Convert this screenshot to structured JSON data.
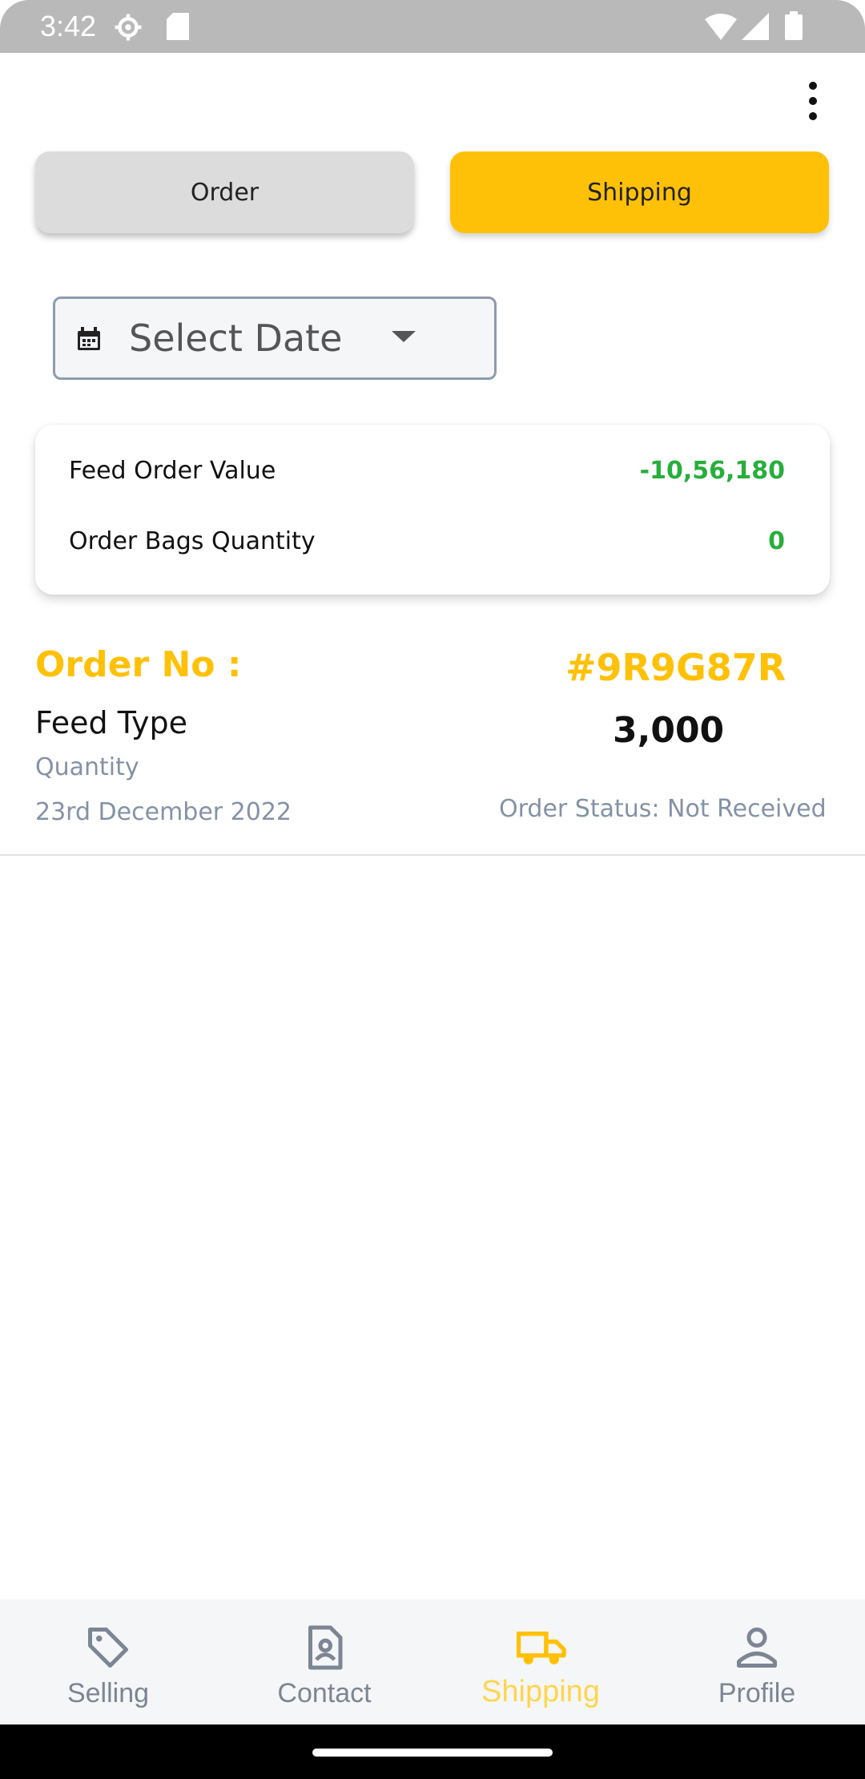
{
  "status_bar": {
    "time": "3:42"
  },
  "tabs": {
    "order": "Order",
    "shipping": "Shipping",
    "active": "shipping"
  },
  "date_filter": {
    "placeholder": "Select Date"
  },
  "summary": {
    "feed_order_value_label": "Feed Order Value",
    "feed_order_value": "-10,56,180",
    "order_bags_quantity_label": "Order Bags Quantity",
    "order_bags_quantity": "0",
    "value_color": "#27ae3c"
  },
  "order": {
    "order_no_label": "Order No :",
    "order_no": "#9R9G87R",
    "feed_type": "Feed Type",
    "quantity_value": "3,000",
    "quantity_label": "Quantity",
    "date": "23rd December 2022",
    "status": "Order Status: Not Received"
  },
  "bottom_nav": {
    "items": [
      {
        "label": "Selling",
        "icon": "tag-icon"
      },
      {
        "label": "Contact",
        "icon": "contact-icon"
      },
      {
        "label": "Shipping",
        "icon": "truck-icon",
        "active": true
      },
      {
        "label": "Profile",
        "icon": "user-icon"
      }
    ]
  },
  "colors": {
    "accent": "#ffc107",
    "muted": "#8492a6"
  }
}
